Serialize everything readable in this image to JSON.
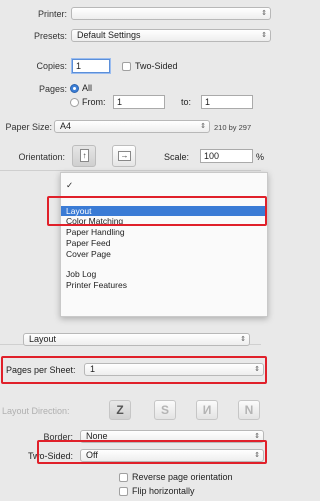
{
  "printer": {
    "label": "Printer:",
    "value": ""
  },
  "presets": {
    "label": "Presets:",
    "value": "Default Settings"
  },
  "copies": {
    "label": "Copies:",
    "value": "1",
    "two_sided_label": "Two-Sided",
    "two_sided_checked": false
  },
  "pages": {
    "label": "Pages:",
    "all_label": "All",
    "from_label": "From:",
    "from_value": "1",
    "to_label": "to:",
    "to_value": "1",
    "selected": "All"
  },
  "paper_size": {
    "label": "Paper Size:",
    "value": "A4",
    "dims": "210 by 297"
  },
  "orientation": {
    "label": "Orientation:",
    "portrait_icon": "portrait-orientation-icon",
    "landscape_icon": "landscape-orientation-icon",
    "selected": "portrait"
  },
  "scale": {
    "label": "Scale:",
    "value": "100",
    "unit": "%"
  },
  "popup_menu": {
    "checkmark": "✓",
    "items": [
      "Layout",
      "Color Matching",
      "Paper Handling",
      "Paper Feed",
      "Cover Page",
      "Job Log",
      "Printer Features"
    ],
    "highlighted": "Layout"
  },
  "section_select": {
    "value": "Layout"
  },
  "pages_per_sheet": {
    "label": "Pages per Sheet:",
    "value": "1"
  },
  "layout_direction": {
    "label": "Layout Direction:",
    "glyphs": [
      "Z",
      "S",
      "И",
      "N"
    ],
    "selected_index": 0
  },
  "border": {
    "label": "Border:",
    "value": "None"
  },
  "two_sided": {
    "label": "Two-Sided:",
    "value": "Off"
  },
  "reverse": {
    "label": "Reverse page orientation",
    "checked": false
  },
  "flip": {
    "label": "Flip horizontally",
    "checked": false
  },
  "accent_color": "#3a7bd5",
  "highlight_box_color": "#e0202a"
}
